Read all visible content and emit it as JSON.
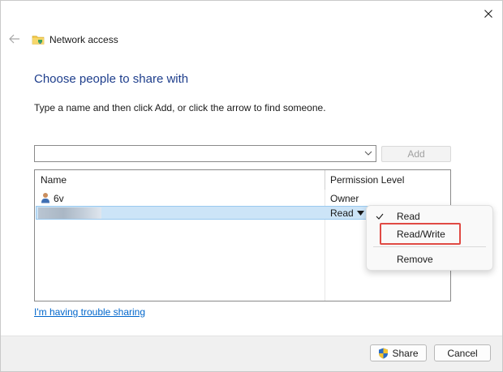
{
  "window": {
    "title": "Network access"
  },
  "heading": "Choose people to share with",
  "instructions": "Type a name and then click Add, or click the arrow to find someone.",
  "name_input": {
    "value": "",
    "placeholder": ""
  },
  "add_button": {
    "label": "Add",
    "enabled": false
  },
  "list": {
    "columns": [
      "Name",
      "Permission Level"
    ],
    "rows": [
      {
        "name": "6v",
        "permission": "Owner",
        "icon": "user-icon"
      },
      {
        "name": "",
        "permission": "Read",
        "selected": true,
        "name_obscured": true
      }
    ]
  },
  "permission_menu": {
    "items": [
      {
        "label": "Read",
        "checked": true
      },
      {
        "label": "Read/Write",
        "checked": false,
        "highlighted": true
      },
      {
        "label": "Remove",
        "checked": false
      }
    ]
  },
  "trouble_link": "I'm having trouble sharing",
  "footer": {
    "share_label": "Share",
    "cancel_label": "Cancel"
  },
  "colors": {
    "heading": "#1e3e8c",
    "link": "#0066cc",
    "selection": "#cce4f7",
    "highlight_box": "#e04a44"
  }
}
